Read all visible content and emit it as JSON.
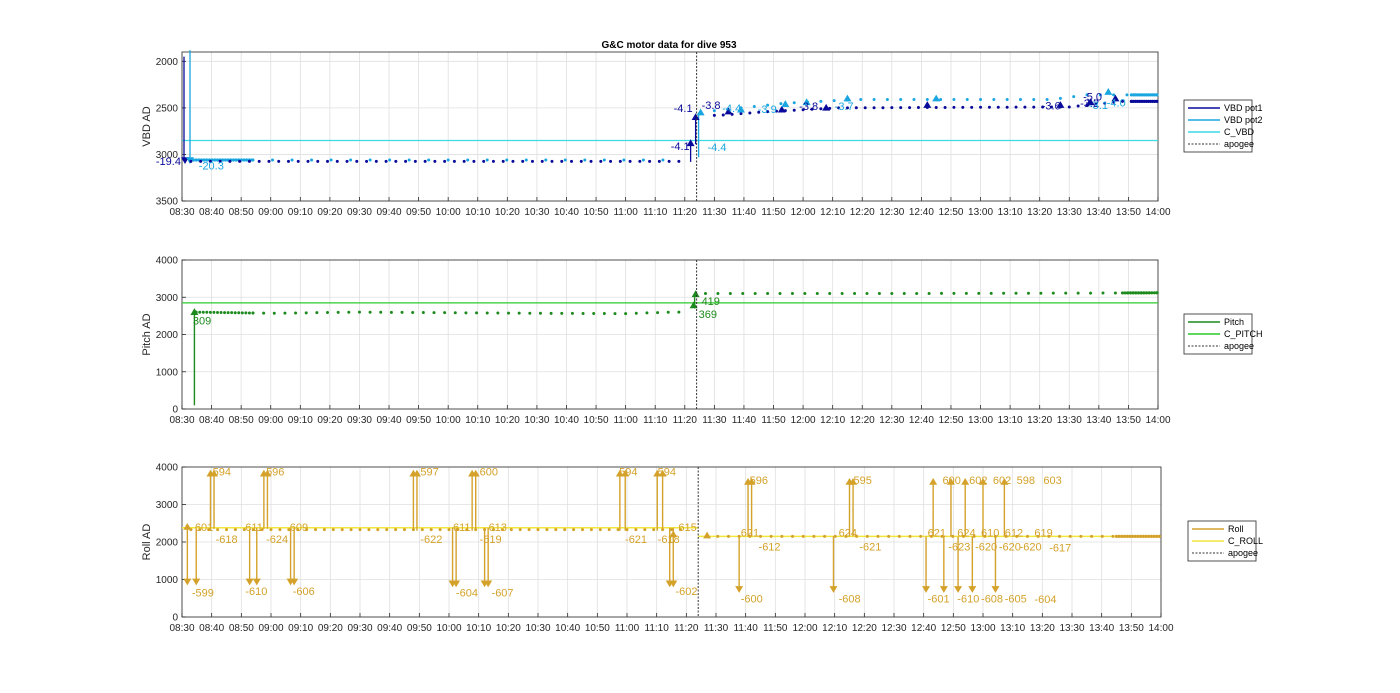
{
  "figure_title": "G&C motor data for dive 953",
  "x_ticks": [
    "08:30",
    "08:40",
    "08:50",
    "09:00",
    "09:10",
    "09:20",
    "09:30",
    "09:40",
    "09:50",
    "10:00",
    "10:10",
    "10:20",
    "10:30",
    "10:40",
    "10:50",
    "11:00",
    "11:10",
    "11:20",
    "11:30",
    "11:40",
    "11:50",
    "12:00",
    "12:10",
    "12:20",
    "12:30",
    "12:40",
    "12:50",
    "13:00",
    "13:10",
    "13:20",
    "13:30",
    "13:40",
    "13:50",
    "14:00"
  ],
  "colors": {
    "vbd_pot1": "#0a0a9a",
    "vbd_pot2": "#1aa6e0",
    "c_vbd": "#3fd9e6",
    "pitch": "#1c8a1c",
    "c_pitch": "#2ccc2c",
    "roll": "#d4a22a",
    "c_roll": "#f0e63c",
    "apogee": "#333333",
    "axes": "#262626",
    "grid": "#dfdfdf"
  },
  "chart_data": [
    {
      "type": "line",
      "title": "G&C motor data for dive 953",
      "ylabel": "VBD AD",
      "ylim": [
        3500,
        1900
      ],
      "y_reversed": true,
      "yticks": [
        2000,
        2500,
        3000,
        3500
      ],
      "xlim": [
        "08:30",
        "14:00"
      ],
      "grid": true,
      "legend": [
        "VBD pot1",
        "VBD pot2",
        "C_VBD",
        "apogee"
      ],
      "legend_position": "outside-right",
      "apogee_time": "11:24",
      "c_vbd": 2850,
      "vbd_pot1_before": 3065,
      "vbd_pot2_before": 3060,
      "vbd_pot1_after": [
        [
          11.53,
          2580
        ],
        [
          11.8,
          2540
        ],
        [
          12.2,
          2500
        ],
        [
          13.5,
          2490
        ],
        [
          13.8,
          2430
        ],
        [
          14.0,
          2430
        ]
      ],
      "vbd_pot2_after": [
        [
          11.5,
          2530
        ],
        [
          11.9,
          2450
        ],
        [
          12.3,
          2410
        ],
        [
          13.4,
          2410
        ],
        [
          13.6,
          2360
        ],
        [
          14.0,
          2360
        ]
      ],
      "vbd_spikes": [
        {
          "x": "08:30",
          "pot1_to": 1950,
          "pot2_to": 1880
        }
      ],
      "annotations": [
        {
          "text": "-19.4",
          "x": "08:31",
          "y": 3070,
          "series": "VBD pot1"
        },
        {
          "text": "-20.3",
          "x": "08:35",
          "y": 3120,
          "series": "VBD pot2"
        },
        {
          "text": "-4.1",
          "x": "11:23",
          "y": 2910,
          "series": "VBD pot1"
        },
        {
          "text": "-4.1",
          "x": "11:24",
          "y": 2500,
          "series": "VBD pot1"
        },
        {
          "text": "-4.4",
          "x": "11:27",
          "y": 2920,
          "series": "VBD pot2"
        },
        {
          "text": "-3.8",
          "x": "11:25",
          "y": 2470,
          "series": "VBD pot1"
        },
        {
          "text": "-4.4",
          "x": "11:32",
          "y": 2500,
          "series": "VBD pot2"
        },
        {
          "text": "-3.9",
          "x": "11:44",
          "y": 2510,
          "series": "VBD pot2"
        },
        {
          "text": "-3.8",
          "x": "11:58",
          "y": 2480,
          "series": "VBD pot1"
        },
        {
          "text": "-3.7",
          "x": "12:10",
          "y": 2480,
          "series": "VBD pot2"
        },
        {
          "text": "-3.6",
          "x": "13:20",
          "y": 2475,
          "series": "VBD pot1"
        },
        {
          "text": "-5.0",
          "x": "13:34",
          "y": 2380,
          "series": "VBD pot1"
        },
        {
          "text": "-3.2",
          "x": "13:33",
          "y": 2450,
          "series": "VBD pot1"
        },
        {
          "text": "-3.1",
          "x": "13:36",
          "y": 2470,
          "series": "VBD pot2"
        },
        {
          "text": "-4.0",
          "x": "13:42",
          "y": 2440,
          "series": "VBD pot2"
        }
      ]
    },
    {
      "type": "line",
      "ylabel": "Pitch AD",
      "ylim": [
        0,
        4000
      ],
      "yticks": [
        0,
        1000,
        2000,
        3000,
        4000
      ],
      "xlim": [
        "08:30",
        "14:00"
      ],
      "grid": true,
      "legend": [
        "Pitch",
        "C_PITCH",
        "apogee"
      ],
      "legend_position": "outside-right",
      "apogee_time": "11:24",
      "c_pitch": 2850,
      "pitch_before": [
        [
          8.58,
          2600
        ],
        [
          9.0,
          2570
        ],
        [
          9.5,
          2600
        ],
        [
          10.5,
          2570
        ],
        [
          11.0,
          2560
        ],
        [
          11.25,
          2600
        ]
      ],
      "pitch_after": [
        [
          11.45,
          3100
        ],
        [
          12.5,
          3100
        ],
        [
          13.5,
          3110
        ],
        [
          14.0,
          3120
        ]
      ],
      "annotations": [
        {
          "text": "309",
          "x": "08:33",
          "y": 2370
        },
        {
          "text": "419",
          "x": "11:25",
          "y": 2900
        },
        {
          "text": "369",
          "x": "11:24",
          "y": 2550
        }
      ]
    },
    {
      "type": "line",
      "ylabel": "Roll AD",
      "ylim": [
        0,
        4000
      ],
      "yticks": [
        0,
        1000,
        2000,
        3000,
        4000
      ],
      "xlim": [
        "08:30",
        "14:00"
      ],
      "grid": true,
      "legend": [
        "Roll",
        "C_ROLL",
        "apogee"
      ],
      "legend_position": "outside-right",
      "apogee_time": "11:24",
      "c_roll_before": 2380,
      "c_roll_after": 2150,
      "roll_before": 2330,
      "roll_after": 2150,
      "annotations": [
        {
          "text": "601",
          "x": "08:34",
          "y": 2400
        },
        {
          "text": "-599",
          "x": "08:33",
          "y": 650
        },
        {
          "text": "594",
          "x": "08:40",
          "y": 3880
        },
        {
          "text": "-618",
          "x": "08:41",
          "y": 2080
        },
        {
          "text": "611",
          "x": "08:51",
          "y": 2400
        },
        {
          "text": "-610",
          "x": "08:51",
          "y": 700
        },
        {
          "text": "596",
          "x": "08:58",
          "y": 3880
        },
        {
          "text": "-624",
          "x": "08:58",
          "y": 2080
        },
        {
          "text": "609",
          "x": "09:06",
          "y": 2400
        },
        {
          "text": "-606",
          "x": "09:07",
          "y": 700
        },
        {
          "text": "597",
          "x": "09:50",
          "y": 3880
        },
        {
          "text": "-622",
          "x": "09:50",
          "y": 2080
        },
        {
          "text": "611",
          "x": "10:01",
          "y": 2400
        },
        {
          "text": "-604",
          "x": "10:02",
          "y": 650
        },
        {
          "text": "600",
          "x": "10:10",
          "y": 3880
        },
        {
          "text": "-619",
          "x": "10:10",
          "y": 2080
        },
        {
          "text": "613",
          "x": "10:13",
          "y": 2400
        },
        {
          "text": "-607",
          "x": "10:14",
          "y": 650
        },
        {
          "text": "594",
          "x": "10:57",
          "y": 3880
        },
        {
          "text": "-621",
          "x": "10:59",
          "y": 2080
        },
        {
          "text": "594",
          "x": "11:10",
          "y": 3880
        },
        {
          "text": "-618",
          "x": "11:10",
          "y": 2080
        },
        {
          "text": "615",
          "x": "11:17",
          "y": 2400
        },
        {
          "text": "-602",
          "x": "11:16",
          "y": 700
        },
        {
          "text": "621",
          "x": "11:38",
          "y": 2250
        },
        {
          "text": "-600",
          "x": "11:38",
          "y": 500
        },
        {
          "text": "596",
          "x": "11:41",
          "y": 3650
        },
        {
          "text": "-612",
          "x": "11:44",
          "y": 1880
        },
        {
          "text": "624",
          "x": "12:11",
          "y": 2250
        },
        {
          "text": "-608",
          "x": "12:11",
          "y": 500
        },
        {
          "text": "595",
          "x": "12:16",
          "y": 3650
        },
        {
          "text": "-621",
          "x": "12:18",
          "y": 1880
        },
        {
          "text": "621",
          "x": "12:41",
          "y": 2250
        },
        {
          "text": "-601",
          "x": "12:41",
          "y": 500
        },
        {
          "text": "600",
          "x": "12:46",
          "y": 3650
        },
        {
          "text": "-623",
          "x": "12:48",
          "y": 1880
        },
        {
          "text": "624",
          "x": "12:51",
          "y": 2250
        },
        {
          "text": "-610",
          "x": "12:51",
          "y": 500
        },
        {
          "text": "602",
          "x": "12:55",
          "y": 3650
        },
        {
          "text": "-620",
          "x": "12:57",
          "y": 1880
        },
        {
          "text": "610",
          "x": "12:59",
          "y": 2250
        },
        {
          "text": "-608",
          "x": "12:59",
          "y": 500
        },
        {
          "text": "602",
          "x": "13:03",
          "y": 3650
        },
        {
          "text": "-620",
          "x": "13:05",
          "y": 1880
        },
        {
          "text": "612",
          "x": "13:07",
          "y": 2250
        },
        {
          "text": "-605",
          "x": "13:07",
          "y": 500
        },
        {
          "text": "598",
          "x": "13:11",
          "y": 3650
        },
        {
          "text": "-620",
          "x": "13:12",
          "y": 1880
        },
        {
          "text": "619",
          "x": "13:17",
          "y": 2250
        },
        {
          "text": "-604",
          "x": "13:17",
          "y": 480
        },
        {
          "text": "603",
          "x": "13:20",
          "y": 3650
        },
        {
          "text": "-617",
          "x": "13:22",
          "y": 1850
        }
      ]
    }
  ]
}
